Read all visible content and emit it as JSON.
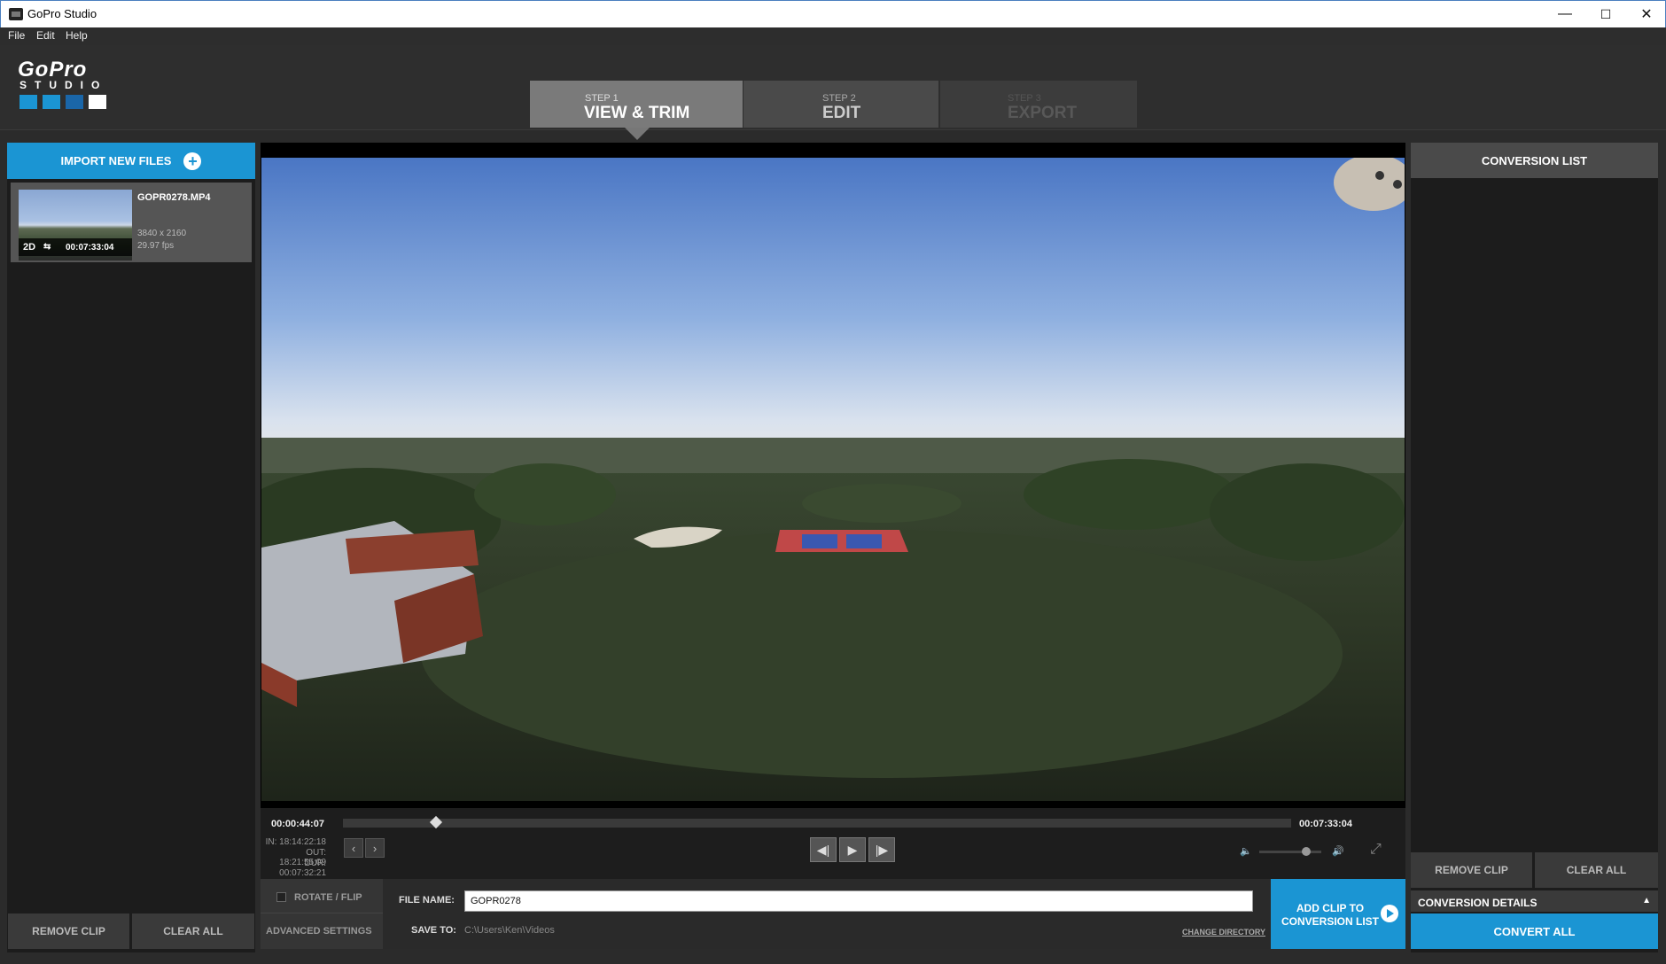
{
  "window": {
    "title": "GoPro Studio",
    "minimize": "—",
    "maximize": "☐",
    "close": "✕"
  },
  "menu": [
    "File",
    "Edit",
    "Help"
  ],
  "logo": {
    "text": "GoPro",
    "sub": "STUDIO"
  },
  "steps": [
    {
      "step": "STEP 1",
      "label": "VIEW & TRIM",
      "state": "active"
    },
    {
      "step": "STEP 2",
      "label": "EDIT",
      "state": "normal"
    },
    {
      "step": "STEP 3",
      "label": "EXPORT",
      "state": "disabled"
    }
  ],
  "left_panel": {
    "import_label": "IMPORT NEW FILES",
    "clip": {
      "name": "GOPR0278.MP4",
      "mode": "2D",
      "duration": "00:07:33:04",
      "resolution": "3840 x 2160",
      "fps": "29.97 fps"
    },
    "remove_clip": "REMOVE CLIP",
    "clear_all": "CLEAR ALL"
  },
  "player": {
    "current_time": "00:00:44:07",
    "total_time": "00:07:33:04",
    "in": "IN: 18:14:22:18",
    "out": "OUT: 18:21:55:09",
    "dur": "DUR: 00:07:32:21",
    "playhead_fraction": 0.098,
    "volume_fraction": 0.75
  },
  "bottom": {
    "rotate_label": "ROTATE / FLIP",
    "advanced_label": "ADVANCED SETTINGS",
    "file_name_label": "FILE NAME:",
    "file_name_value": "GOPR0278",
    "save_to_label": "SAVE TO:",
    "save_to_value": "C:\\Users\\Ken\\Videos",
    "change_directory": "CHANGE DIRECTORY",
    "add_clip_line1": "ADD CLIP TO",
    "add_clip_line2": "CONVERSION LIST"
  },
  "right_panel": {
    "title": "CONVERSION LIST",
    "remove_clip": "REMOVE CLIP",
    "clear_all": "CLEAR ALL",
    "details": "CONVERSION DETAILS",
    "convert_all": "CONVERT ALL"
  },
  "colors": {
    "accent": "#1b95d3",
    "panel": "#1c1c1c",
    "background": "#2b2b2b"
  }
}
